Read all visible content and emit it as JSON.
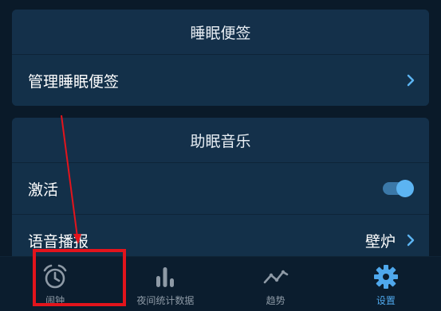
{
  "sleep_notes_card": {
    "header": "睡眠便签",
    "rows": [
      {
        "label": "管理睡眠便签"
      }
    ]
  },
  "sleep_music_card": {
    "header": "助眠音乐",
    "rows": [
      {
        "label": "激活",
        "toggle_on": true
      },
      {
        "label": "语音播报",
        "value": "壁炉"
      }
    ]
  },
  "tabbar": {
    "tabs": [
      {
        "label": "闹钟",
        "icon": "alarm-clock-icon",
        "active": false
      },
      {
        "label": "夜间统计数据",
        "icon": "bar-chart-icon",
        "active": false
      },
      {
        "label": "趋势",
        "icon": "trend-line-icon",
        "active": false
      },
      {
        "label": "设置",
        "icon": "gear-icon",
        "active": true
      }
    ]
  },
  "colors": {
    "accent": "#4fa8ec",
    "highlight": "#e3141c",
    "inactive": "#8e9aa6"
  }
}
